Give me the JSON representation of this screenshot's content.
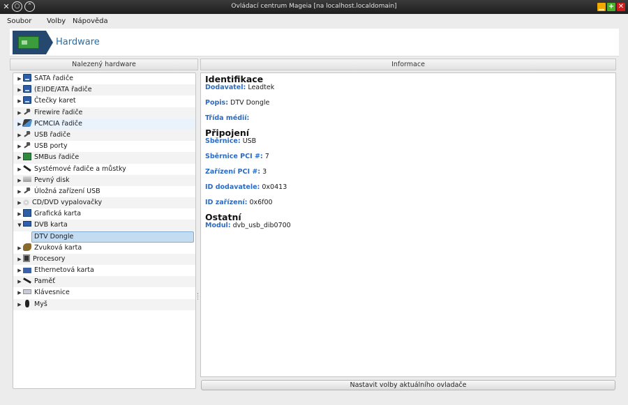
{
  "window": {
    "title": "Ovládací centrum Mageia  [na localhost.localdomain]"
  },
  "menu": [
    {
      "label": "Soubor"
    },
    {
      "label": "Volby"
    },
    {
      "label": "Nápověda"
    }
  ],
  "banner": {
    "title": "Hardware",
    "icon": "network-card-icon"
  },
  "left_panel": {
    "header": "Nalezený hardware",
    "items": [
      {
        "label": "SATA řadiče",
        "icon": "disk-controller-icon"
      },
      {
        "label": "(E)IDE/ATA řadiče",
        "icon": "disk-controller-icon"
      },
      {
        "label": "Čtečky karet",
        "icon": "card-reader-icon"
      },
      {
        "label": "Firewire řadiče",
        "icon": "firewire-icon"
      },
      {
        "label": "PCMCIA řadiče",
        "icon": "pcmcia-icon"
      },
      {
        "label": "USB řadiče",
        "icon": "usb-icon"
      },
      {
        "label": "USB porty",
        "icon": "usb-icon"
      },
      {
        "label": "SMBus řadiče",
        "icon": "smbus-icon"
      },
      {
        "label": "Systémové řadiče a můstky",
        "icon": "bridge-icon"
      },
      {
        "label": "Pevný disk",
        "icon": "hard-disk-icon"
      },
      {
        "label": "Úložná zařízení USB",
        "icon": "usb-storage-icon"
      },
      {
        "label": "CD/DVD vypalovačky",
        "icon": "cd-icon"
      },
      {
        "label": "Grafická karta",
        "icon": "graphics-card-icon"
      },
      {
        "label": "DVB karta",
        "icon": "dvb-card-icon",
        "expanded": true
      },
      {
        "label": "DTV Dongle",
        "child": true,
        "selected": true
      },
      {
        "label": "Zvuková karta",
        "icon": "sound-card-icon"
      },
      {
        "label": "Procesory",
        "icon": "cpu-icon"
      },
      {
        "label": "Ethernetová karta",
        "icon": "ethernet-icon"
      },
      {
        "label": "Paměť",
        "icon": "memory-icon"
      },
      {
        "label": "Klávesnice",
        "icon": "keyboard-icon"
      },
      {
        "label": "Myš",
        "icon": "mouse-icon"
      }
    ]
  },
  "right_panel": {
    "header": "Informace",
    "identifikace": {
      "heading": "Identifikace",
      "vendor_label": "Dodavatel:",
      "vendor_value": "Leadtek",
      "desc_label": "Popis:",
      "desc_value": "DTV Dongle",
      "class_label": "Třída médií:"
    },
    "pripojeni": {
      "heading": "Připojení",
      "bus_label": "Sběrnice:",
      "bus_value": "USB",
      "pcibus_label": "Sběrnice PCI #:",
      "pcibus_value": "7",
      "pcidev_label": "Zařízení PCI #:",
      "pcidev_value": "3",
      "vendorid_label": "ID dodavatele:",
      "vendorid_value": "0x0413",
      "devid_label": "ID zařízení:",
      "devid_value": "0x6f00"
    },
    "ostatni": {
      "heading": "Ostatní",
      "module_label": "Modul:",
      "module_value": "dvb_usb_dib0700"
    }
  },
  "buttons": {
    "configure": "Nastavit volby aktuálního ovladače"
  }
}
